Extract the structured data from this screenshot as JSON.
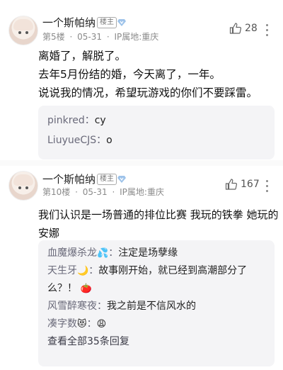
{
  "posts": [
    {
      "username": "一个斯帕纳",
      "owner_badge": "楼主",
      "floor": "第5楼",
      "date": "05-31",
      "ip": "IP属地:重庆",
      "likes": "28",
      "content_lines": [
        "离婚了，解脱了。",
        "去年5月份结的婚，今天离了，一年。",
        "说说我的情况，希望玩游戏的你们不要踩雷。"
      ],
      "replies": [
        {
          "name": "pinkred：",
          "text": "cy"
        },
        {
          "name": "LiuyueCJS：",
          "text": "o"
        }
      ]
    },
    {
      "username": "一个斯帕纳",
      "owner_badge": "楼主",
      "floor": "第10楼",
      "date": "05-31",
      "ip": "IP属地:重庆",
      "likes": "167",
      "content_lines": [
        "我们认识是一场普通的排位比赛 我玩的铁拳 她玩的",
        "安娜"
      ],
      "replies": [
        {
          "name": "血魔爆杀龙",
          "emoji": "💦",
          "sep": "：",
          "text": "注定是场孽缘"
        },
        {
          "name": "天生牙",
          "emoji": "🌙",
          "sep": "：",
          "text": "故事刚开始，就已经到高潮部分了"
        },
        {
          "name": "",
          "text": "么？！",
          "emoji_after": "🍅"
        },
        {
          "name": "风雪醉寒夜：",
          "text": "我之前是不信风水的"
        },
        {
          "name": "凑字数",
          "emoji": "😻",
          "sep": "：",
          "emoji_after": "😩",
          "text": ""
        }
      ],
      "view_all": "查看全部35条回复"
    }
  ],
  "icons": {
    "like": "thumbs-up-icon",
    "more": "vertical-dots-icon",
    "level": "diamond-level-icon"
  }
}
